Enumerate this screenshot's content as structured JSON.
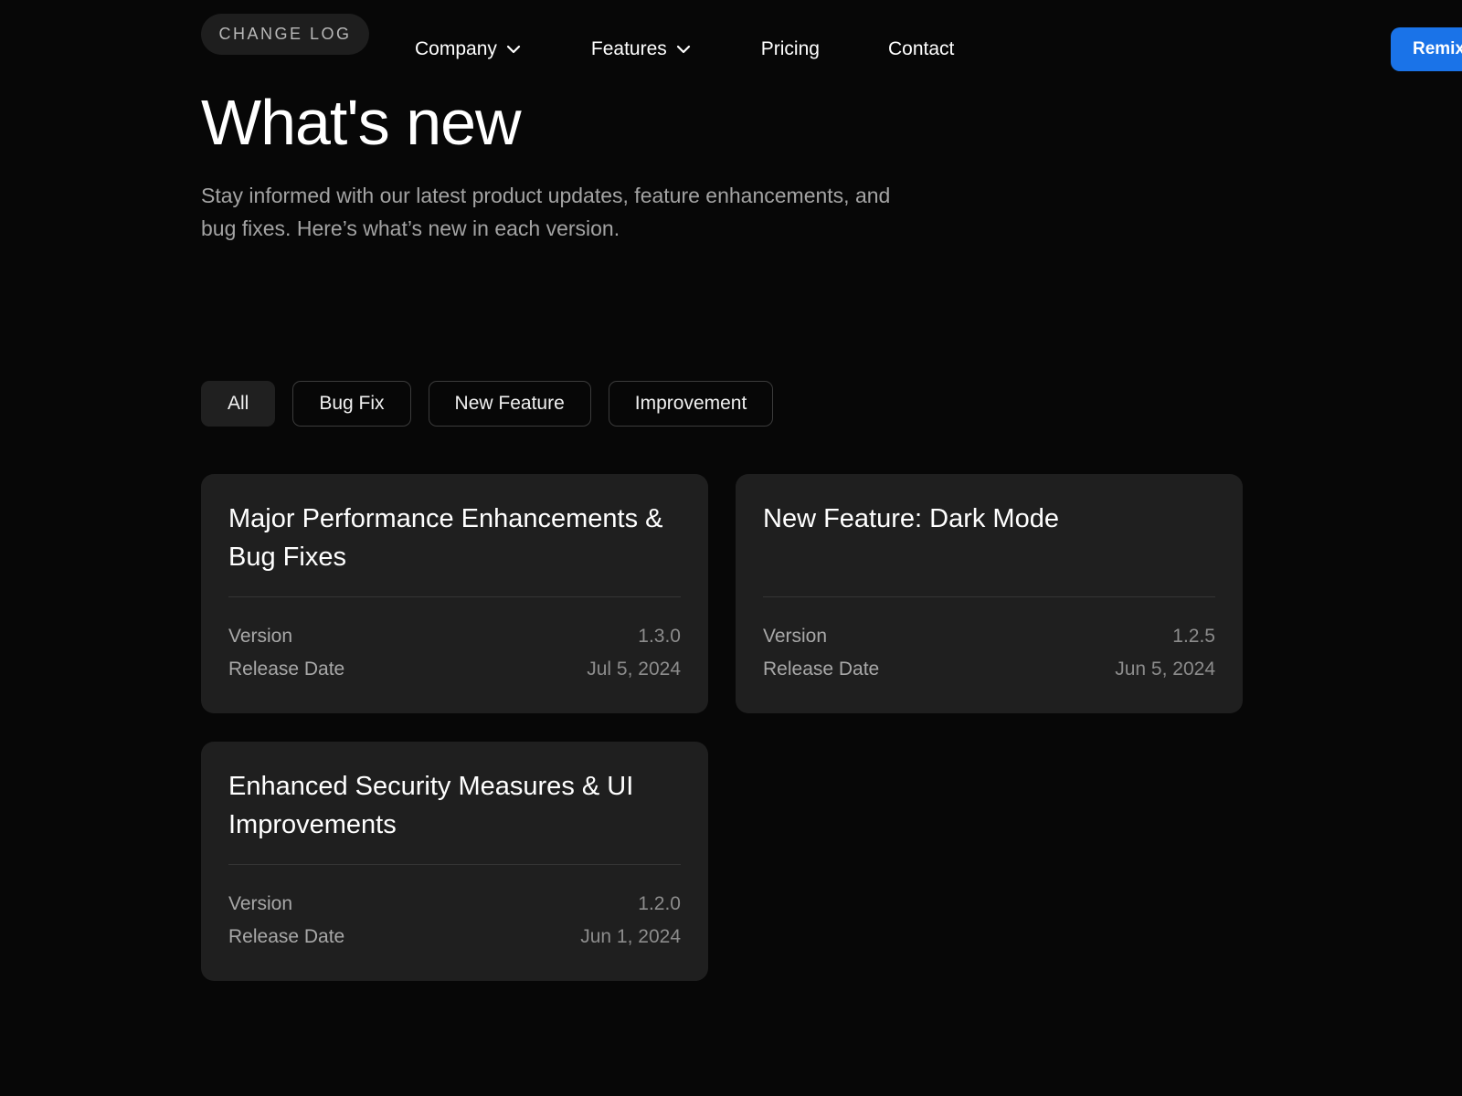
{
  "header": {
    "badge": "CHANGE LOG",
    "nav": [
      {
        "label": "Company",
        "has_dropdown": true
      },
      {
        "label": "Features",
        "has_dropdown": true
      },
      {
        "label": "Pricing",
        "has_dropdown": false
      },
      {
        "label": "Contact",
        "has_dropdown": false
      }
    ],
    "cta_label": "Remix",
    "cta_color": "#1a73e8"
  },
  "hero": {
    "title": "What's new",
    "subtitle": "Stay informed with our latest product updates, feature enhancements, and bug fixes. Here’s what’s new in each version."
  },
  "filters": {
    "items": [
      "All",
      "Bug Fix",
      "New Feature",
      "Improvement"
    ],
    "selected": "All"
  },
  "changelog": {
    "version_label": "Version",
    "release_label": "Release Date",
    "entries": [
      {
        "title": "Major Performance Enhancements & Bug Fixes",
        "version": "1.3.0",
        "release_date": "Jul 5, 2024"
      },
      {
        "title": "New Feature: Dark Mode",
        "version": "1.2.5",
        "release_date": "Jun 5, 2024"
      },
      {
        "title": "Enhanced Security Measures & UI Improvements",
        "version": "1.2.0",
        "release_date": "Jun 1, 2024"
      }
    ]
  }
}
